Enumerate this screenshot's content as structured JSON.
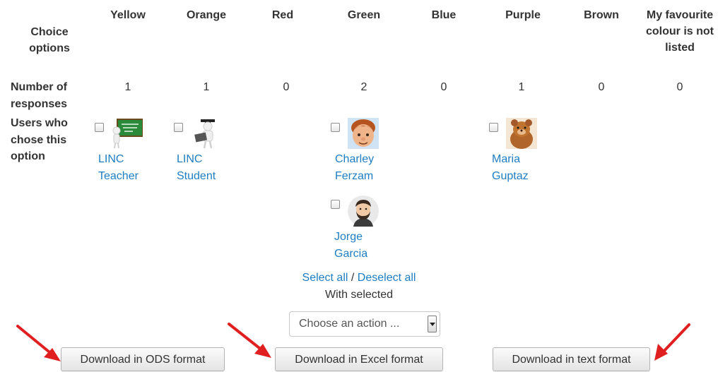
{
  "table": {
    "header_label": "Choice options",
    "options": [
      "Yellow",
      "Orange",
      "Red",
      "Green",
      "Blue",
      "Purple",
      "Brown",
      "My favourite colour is not listed"
    ],
    "responses_label": "Number of responses",
    "responses": [
      "1",
      "1",
      "0",
      "2",
      "0",
      "1",
      "0",
      "0"
    ],
    "users_label": "Users who chose this option",
    "users": {
      "linc_teacher": {
        "first": "LINC",
        "last": "Teacher"
      },
      "linc_student": {
        "first": "LINC",
        "last": "Student"
      },
      "charley_ferzam": {
        "first": "Charley",
        "last": "Ferzam"
      },
      "jorge_garcia": {
        "first": "Jorge",
        "last": "Garcia"
      },
      "maria_guptaz": {
        "first": "Maria",
        "last": "Guptaz"
      }
    }
  },
  "selection": {
    "select_all": "Select all",
    "separator": " / ",
    "deselect_all": "Deselect all",
    "with_selected": "With selected",
    "action_placeholder": "Choose an action ..."
  },
  "downloads": {
    "ods": "Download in ODS format",
    "excel": "Download in Excel format",
    "text": "Download in text format"
  },
  "annotation_color": "#e02020",
  "link_color": "#1f7dc1"
}
